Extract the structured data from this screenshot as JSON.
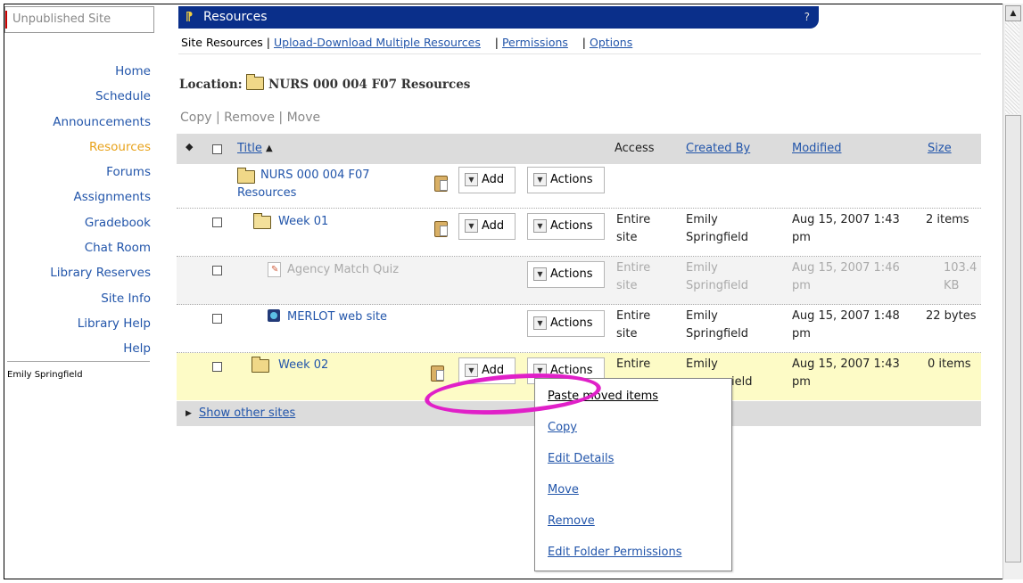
{
  "site_indicator": "Unpublished Site",
  "sidebar": {
    "items": [
      {
        "label": "Home"
      },
      {
        "label": "Schedule"
      },
      {
        "label": "Announcements"
      },
      {
        "label": "Resources",
        "active": true
      },
      {
        "label": "Forums"
      },
      {
        "label": "Assignments"
      },
      {
        "label": "Gradebook"
      },
      {
        "label": "Chat Room"
      },
      {
        "label": "Library Reserves"
      },
      {
        "label": "Site Info"
      },
      {
        "label": "Library Help"
      },
      {
        "label": "Help"
      }
    ],
    "user": "Emily Springfield"
  },
  "tool": {
    "title": "Resources",
    "help": "?"
  },
  "subnav": {
    "current": "Site Resources",
    "links": [
      "Upload-Download Multiple Resources",
      "Permissions",
      "Options"
    ]
  },
  "location": {
    "label": "Location:",
    "name": "NURS 000 004 F07 Resources"
  },
  "commands": [
    "Copy",
    "Remove",
    "Move"
  ],
  "table": {
    "headers": {
      "title": "Title",
      "access": "Access",
      "created_by": "Created By",
      "modified": "Modified",
      "size": "Size"
    },
    "rows": [
      {
        "title_l1": "NURS 000 004 F07",
        "title_l2": "Resources",
        "add": "Add",
        "actions": "Actions"
      },
      {
        "title": "Week 01",
        "add": "Add",
        "actions": "Actions",
        "access_l1": "Entire",
        "access_l2": "site",
        "by_l1": "Emily",
        "by_l2": "Springfield",
        "mod_l1": "Aug 15, 2007 1:43",
        "mod_l2": "pm",
        "size": "2 items"
      },
      {
        "title": "Agency Match Quiz",
        "actions": "Actions",
        "access_l1": "Entire",
        "access_l2": "site",
        "by_l1": "Emily",
        "by_l2": "Springfield",
        "mod_l1": "Aug 15, 2007 1:46",
        "mod_l2": "pm",
        "size_l1": "103.4",
        "size_l2": "KB"
      },
      {
        "title": "MERLOT web site",
        "actions": "Actions",
        "access_l1": "Entire",
        "access_l2": "site",
        "by_l1": "Emily",
        "by_l2": "Springfield",
        "mod_l1": "Aug 15, 2007 1:48",
        "mod_l2": "pm",
        "size": "22 bytes"
      },
      {
        "title": "Week 02",
        "add": "Add",
        "actions": "Actions",
        "access_l1": "Entire",
        "by_l1": "Emily",
        "by_l2": "ield",
        "mod_l1": "Aug 15, 2007 1:43",
        "mod_l2": "pm",
        "size": "0 items"
      }
    ]
  },
  "show_other": "Show other sites",
  "actions_menu": [
    "Paste moved items",
    "Copy",
    "Edit Details",
    "Move",
    "Remove",
    "Edit Folder Permissions"
  ],
  "colors": {
    "header_bg": "#0a2f8a",
    "link": "#2255aa",
    "active_nav": "#e8a21a",
    "highlight_row": "#fdfbc6",
    "annotation": "#e020c8"
  }
}
